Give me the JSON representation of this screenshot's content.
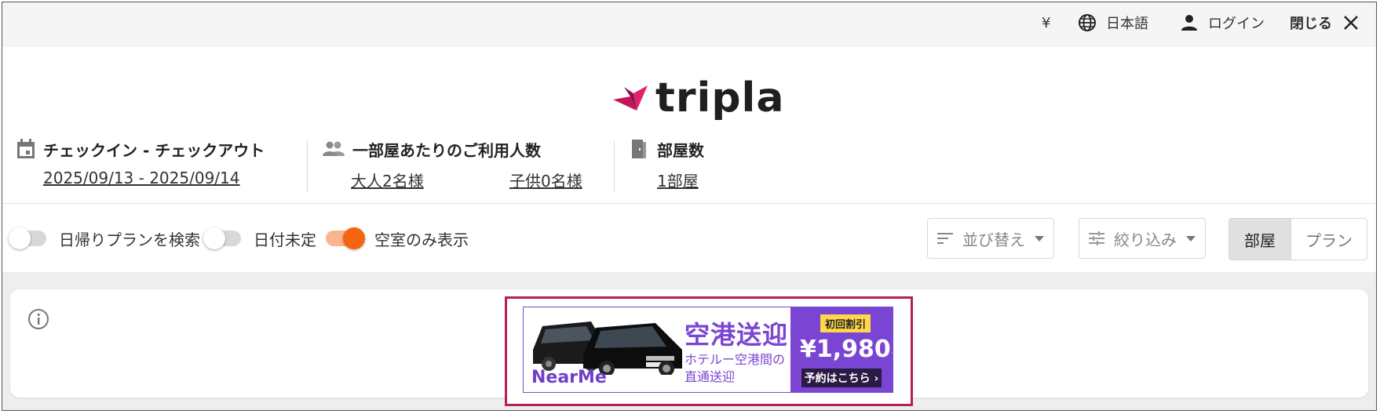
{
  "topbar": {
    "currency": "¥",
    "language": "日本語",
    "login": "ログイン",
    "close": "閉じる"
  },
  "logo": {
    "text": "tripla"
  },
  "search": {
    "dates": {
      "label": "チェックイン - チェックアウト",
      "value": "2025/09/13 - 2025/09/14"
    },
    "guests": {
      "label": "一部屋あたりのご利用人数",
      "adults": "大人2名様",
      "children": "子供0名様"
    },
    "rooms": {
      "label": "部屋数",
      "value": "1部屋"
    }
  },
  "filters": {
    "day_trip": {
      "label": "日帰りプランを検索",
      "on": false
    },
    "undecided_date": {
      "label": "日付未定",
      "on": false
    },
    "vacancy_only": {
      "label": "空室のみ表示",
      "on": true
    },
    "sort_label": "並び替え",
    "filter_label": "絞り込み",
    "view_toggle": {
      "active": "部屋",
      "inactive": "プラン"
    }
  },
  "banner": {
    "brand": "NearMe",
    "title": "空港送迎",
    "subtitle_line1": "ホテルー空港間の",
    "subtitle_line2": "直通送迎",
    "badge": "初回割引",
    "price": "¥1,980",
    "price_suffix": "~",
    "cta": "予約はこちら ›",
    "accent_color": "#7a45d3",
    "outline_color": "#b5205a"
  },
  "colors": {
    "toggle_on": "#f5640e",
    "logo_bird": "#c2185b"
  }
}
